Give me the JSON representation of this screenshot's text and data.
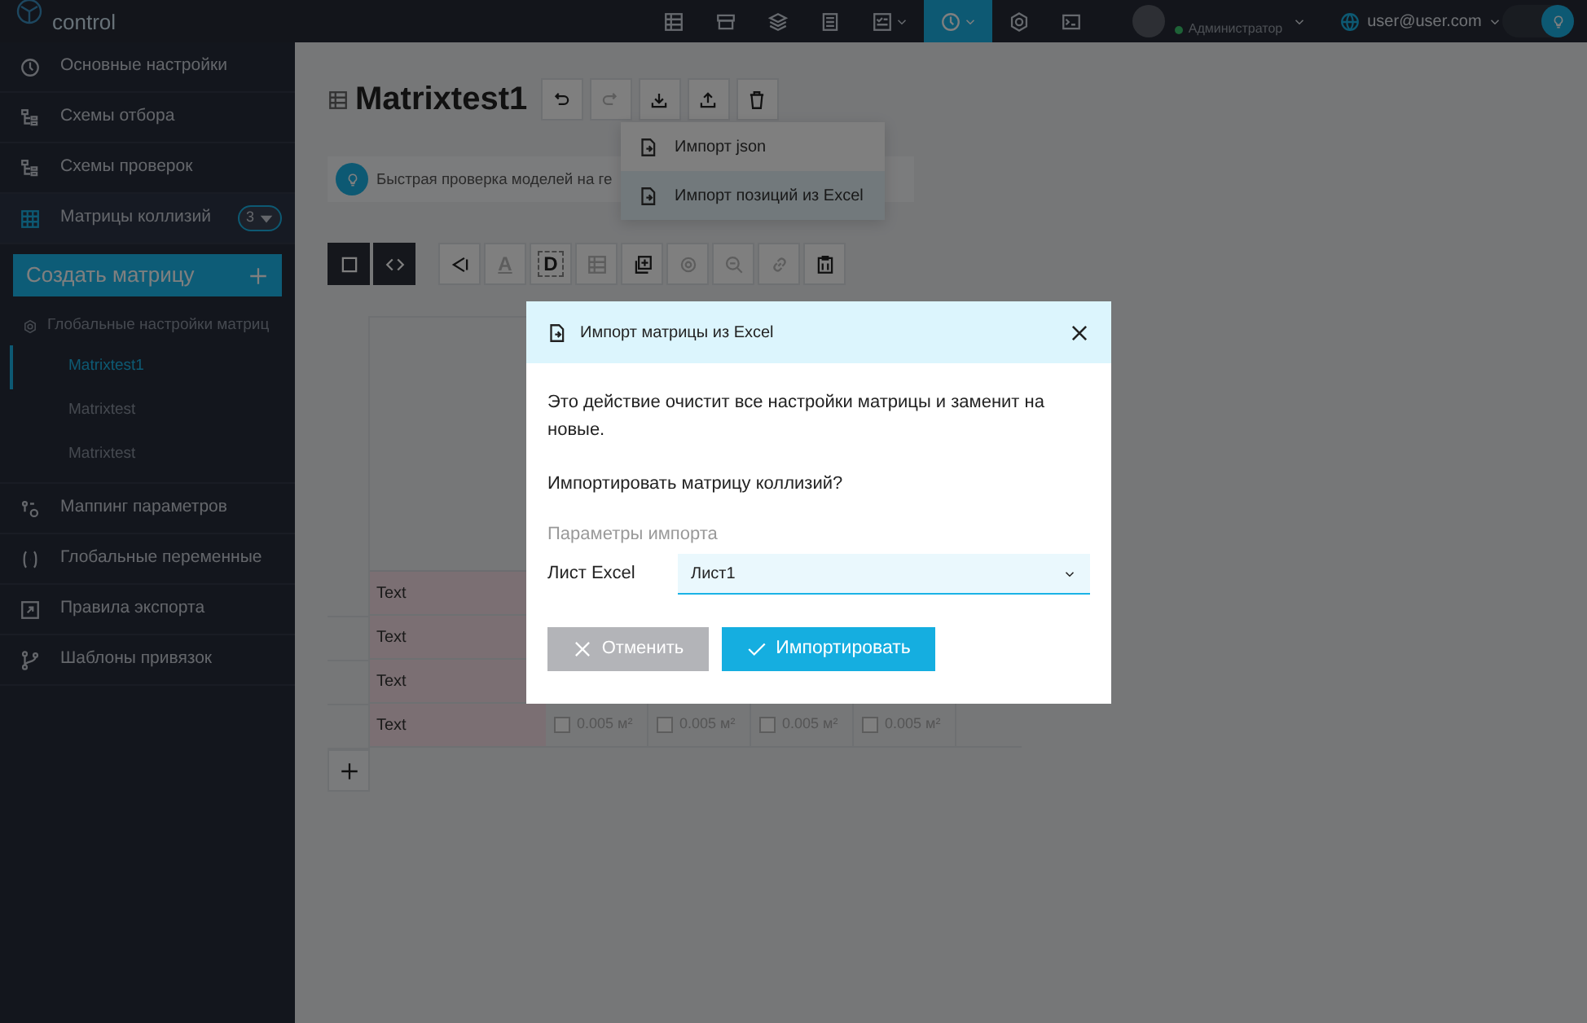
{
  "header": {
    "logo": {
      "line2": "control"
    },
    "tools": [
      {
        "kind": "table",
        "selected": false,
        "dropdown": false
      },
      {
        "kind": "archive",
        "selected": false,
        "dropdown": false
      },
      {
        "kind": "layers",
        "selected": false,
        "dropdown": false
      },
      {
        "kind": "list",
        "selected": false,
        "dropdown": false
      },
      {
        "kind": "checklist",
        "selected": false,
        "dropdown": true
      },
      {
        "kind": "clock",
        "selected": true,
        "dropdown": true
      },
      {
        "kind": "gear",
        "selected": false,
        "dropdown": false
      },
      {
        "kind": "terminal",
        "selected": false,
        "dropdown": false
      }
    ],
    "user": {
      "role": "Администратор"
    },
    "account": "user@user.com",
    "theme_toggle": {
      "on": true
    }
  },
  "sidebar": {
    "items": [
      {
        "label": "Основные настройки",
        "kind": "clock",
        "selected": false
      },
      {
        "label": "Схемы отбора",
        "kind": "tree",
        "selected": false
      },
      {
        "label": "Схемы проверок",
        "kind": "tree",
        "selected": false
      },
      {
        "label": "Матрицы коллизий",
        "kind": "grid",
        "selected": true,
        "badge": "3"
      }
    ],
    "create_button": "Создать матрицу",
    "matrices": {
      "global": "Глобальные настройки матриц",
      "items": [
        {
          "label": "Matrixtest1",
          "selected": true
        },
        {
          "label": "Matrixtest",
          "selected": false
        },
        {
          "label": "Matrixtest",
          "selected": false
        }
      ]
    },
    "more_items": [
      {
        "label": "Маппинг параметров",
        "kind": "mapping",
        "selected": false
      },
      {
        "label": "Глобальные переменные",
        "kind": "brackets",
        "selected": false
      },
      {
        "label": "Правила экспорта",
        "kind": "export",
        "selected": false
      },
      {
        "label": "Шаблоны привязок",
        "kind": "branch",
        "selected": false
      }
    ]
  },
  "page": {
    "title": "Matrixtest1",
    "actions": [
      {
        "kind": "undo",
        "disabled": false
      },
      {
        "kind": "redo",
        "disabled": true
      },
      {
        "kind": "download",
        "disabled": false
      },
      {
        "kind": "upload",
        "disabled": false
      },
      {
        "kind": "trash",
        "disabled": false
      }
    ],
    "import_menu": [
      {
        "label": "Импорт json",
        "selected": false
      },
      {
        "label": "Импорт позиций из Excel",
        "selected": true
      }
    ],
    "hint": "Быстрая проверка моделей на ге",
    "view_toggles": [
      {
        "kind": "square",
        "active": true
      },
      {
        "kind": "code",
        "active": true
      }
    ],
    "toolbar": [
      {
        "kind": "shape",
        "disabled": false
      },
      {
        "kind": "letter",
        "glyph": "A",
        "disabled": true
      },
      {
        "kind": "letter-box",
        "glyph": "D",
        "disabled": false
      },
      {
        "kind": "table",
        "disabled": true
      },
      {
        "kind": "copy-plus",
        "disabled": false
      },
      {
        "kind": "eye",
        "disabled": true
      },
      {
        "kind": "zoom",
        "disabled": true
      },
      {
        "kind": "link",
        "disabled": true
      },
      {
        "kind": "clipboard-trash",
        "disabled": false
      }
    ],
    "table": {
      "rows": [
        {
          "label": "Text",
          "cells": []
        },
        {
          "label": "Text",
          "cells": []
        },
        {
          "label": "Text",
          "cells": []
        },
        {
          "label": "Text",
          "cells": [
            {
              "text": "0.005 м²",
              "checked": false
            },
            {
              "text": "0.005 м²",
              "checked": false
            },
            {
              "text": "0.005 м²",
              "checked": false
            },
            {
              "text": "0.005 м²",
              "checked": false
            }
          ]
        }
      ]
    }
  },
  "dialog": {
    "title": "Импорт матрицы из Excel",
    "paragraphs": [
      "Это действие очистит все настройки матрицы и заменит на новые.",
      "Импортировать матрицу коллизий?"
    ],
    "section": "Параметры импорта",
    "field_label": "Лист Excel",
    "field_value": "Лист1",
    "cancel": {
      "label": "Отменить",
      "disabled": true
    },
    "confirm": {
      "label": "Импортировать",
      "disabled": false
    }
  }
}
